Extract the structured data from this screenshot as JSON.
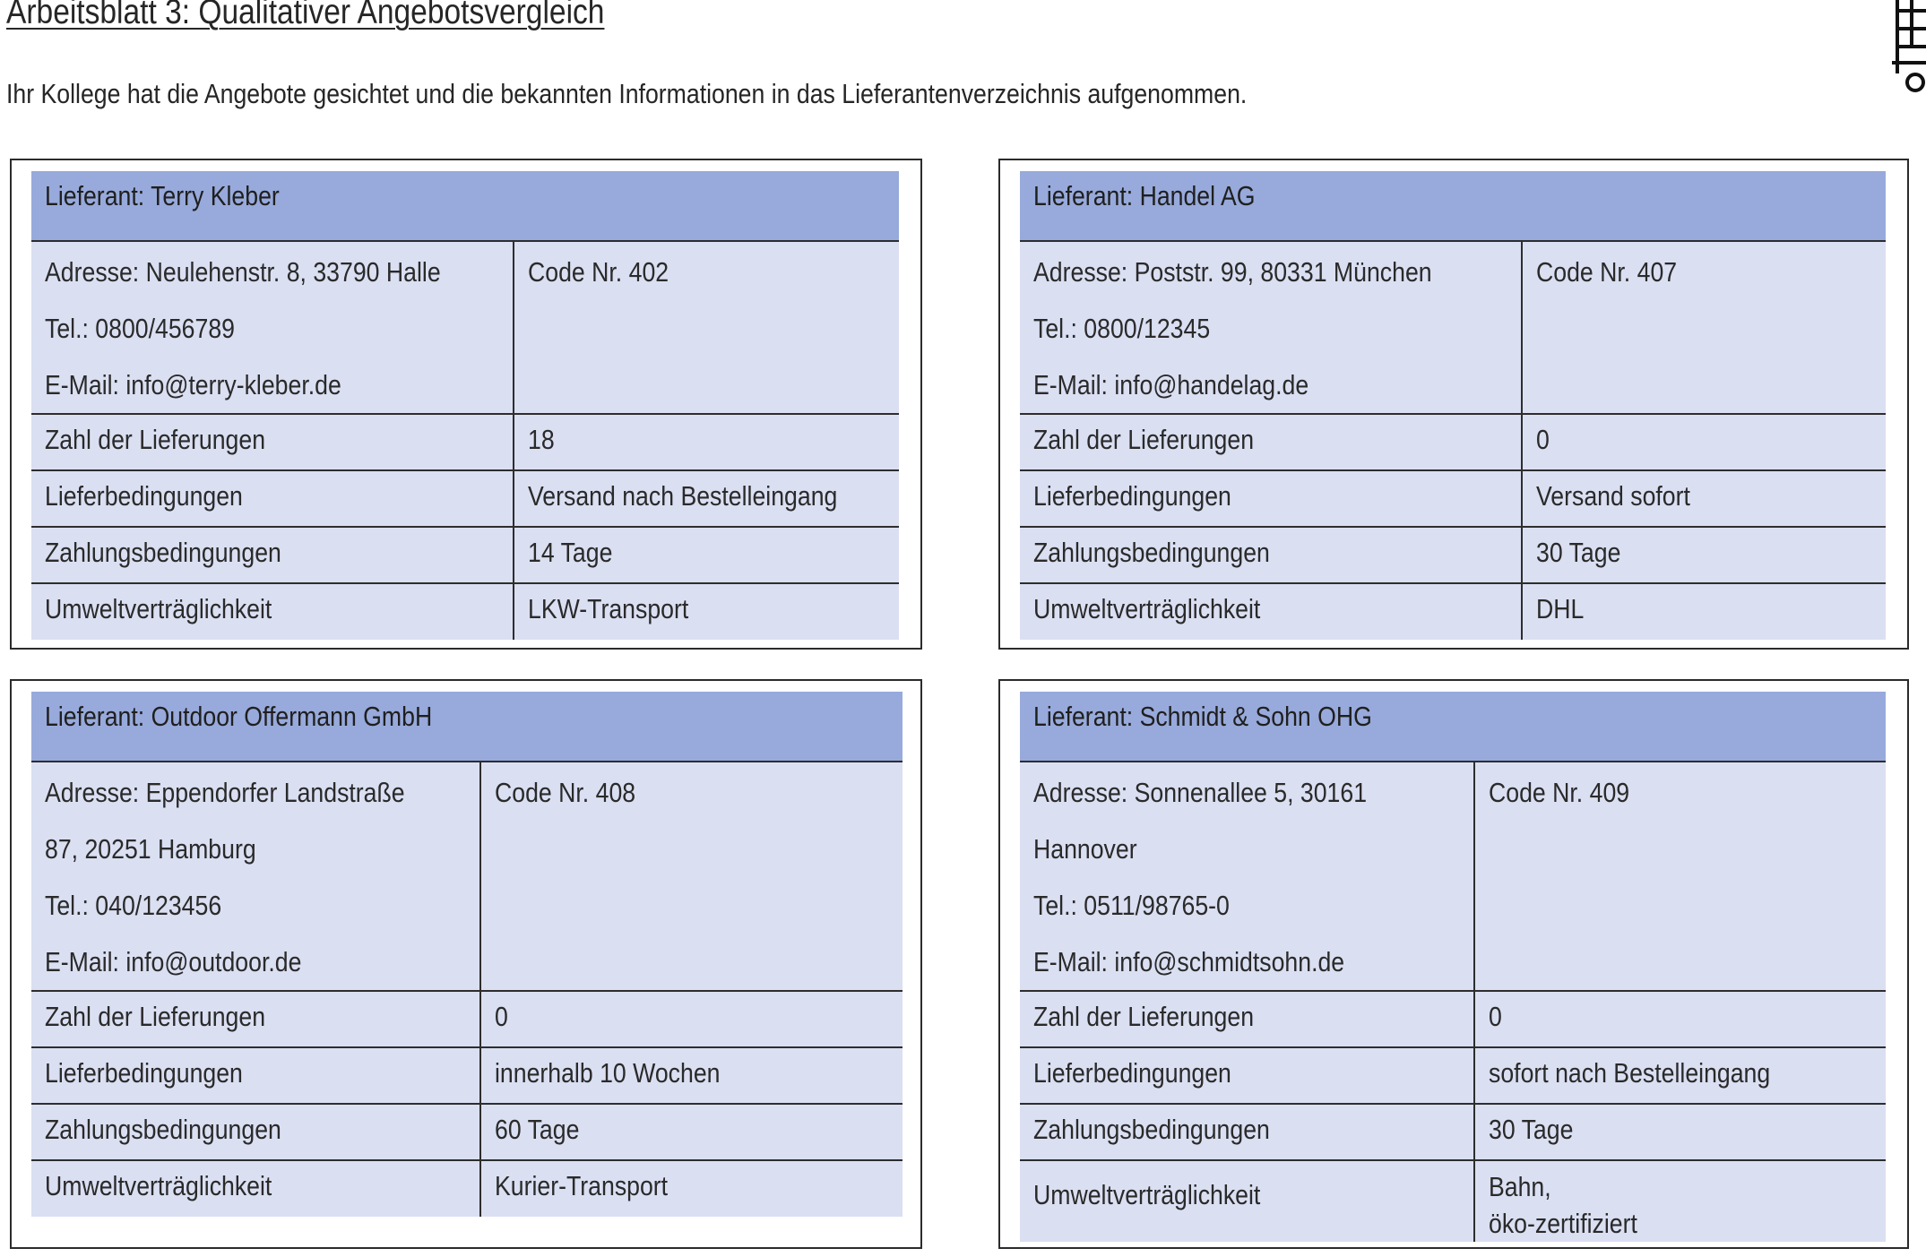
{
  "title": "Arbeitsblatt 3: Qualitativer Angebotsvergleich",
  "intro": "Ihr Kollege hat die Angebote gesichtet und die bekannten Informationen in das Lieferantenverzeichnis aufgenommen.",
  "labels": {
    "deliveries": "Zahl der Lieferungen",
    "delivery_terms": "Lieferbedingungen",
    "payment_terms": "Zahlungsbedingungen",
    "environment": "Umweltverträglichkeit"
  },
  "suppliers": [
    {
      "header": "Lieferant: Terry Kleber",
      "address_lines": [
        "Adresse: Neulehenstr. 8, 33790 Halle",
        "Tel.: 0800/456789",
        "E-Mail: info@terry-kleber.de"
      ],
      "code": "Code Nr. 402",
      "deliveries": "18",
      "delivery_terms": "Versand nach Bestelleingang",
      "payment_terms": "14 Tage",
      "environment": "LKW-Transport"
    },
    {
      "header": "Lieferant: Handel AG",
      "address_lines": [
        "Adresse: Poststr. 99, 80331 München",
        "Tel.: 0800/12345",
        "E-Mail: info@handelag.de"
      ],
      "code": "Code Nr. 407",
      "deliveries": "0",
      "delivery_terms": "Versand sofort",
      "payment_terms": "30 Tage",
      "environment": "DHL"
    },
    {
      "header": "Lieferant: Outdoor Offermann GmbH",
      "address_lines": [
        "Adresse: Eppendorfer Landstraße",
        "87, 20251 Hamburg",
        "Tel.: 040/123456",
        "E-Mail: info@outdoor.de"
      ],
      "code": "Code Nr. 408",
      "deliveries": "0",
      "delivery_terms": "innerhalb 10 Wochen",
      "payment_terms": "60 Tage",
      "environment": "Kurier-Transport"
    },
    {
      "header": "Lieferant: Schmidt & Sohn OHG",
      "address_lines": [
        "Adresse: Sonnenallee 5, 30161",
        "Hannover",
        "Tel.: 0511/98765-0",
        "E-Mail: info@schmidtsohn.de"
      ],
      "code": "Code Nr. 409",
      "deliveries": "0",
      "delivery_terms": "sofort nach Bestelleingang",
      "payment_terms": "30 Tage",
      "environment_lines": [
        "Bahn,",
        "öko-zertifiziert"
      ]
    }
  ],
  "icons": {
    "logo": "cart-grid-icon"
  }
}
